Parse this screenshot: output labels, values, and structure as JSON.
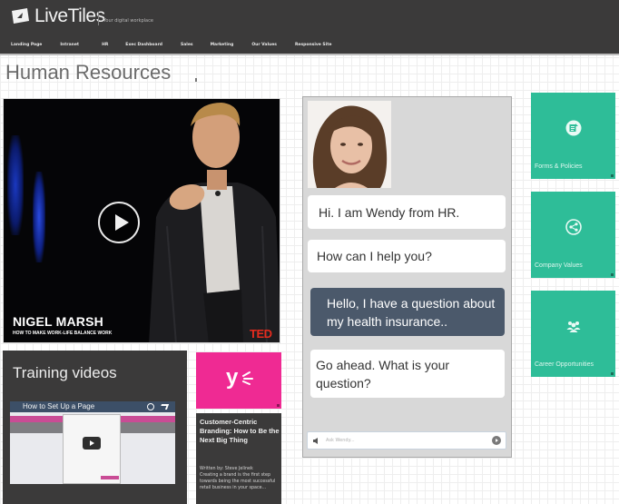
{
  "header": {
    "brand": "LiveTiles",
    "tagline": "Your digital workplace",
    "nav": [
      "Landing Page",
      "Intranet",
      "HR",
      "Exec Dashboard",
      "Sales",
      "Marketing",
      "Our Values",
      "Responsive Site"
    ]
  },
  "page": {
    "title": "Human Resources"
  },
  "video": {
    "speaker_name": "NIGEL MARSH",
    "talk_title": "HOW TO MAKE WORK-LIFE BALANCE WORK",
    "brand_mark": "TED",
    "play_icon": "play-icon"
  },
  "chat": {
    "agent_name": "Wendy",
    "messages": [
      {
        "from": "bot",
        "text": "Hi. I am Wendy from HR."
      },
      {
        "from": "bot",
        "text": "How can I help you?"
      },
      {
        "from": "user",
        "text": "Hello, I have a question about my health insurance.."
      },
      {
        "from": "bot",
        "text": "Go ahead. What is your question?"
      }
    ],
    "input_placeholder": "Ask Wendy...",
    "input_value": ""
  },
  "tiles": {
    "forms": {
      "label": "Forms & Policies",
      "icon": "forms-icon"
    },
    "values": {
      "label": "Company Values",
      "icon": "share-icon"
    },
    "career": {
      "label": "Career Opportunities",
      "icon": "people-icon"
    }
  },
  "training": {
    "title": "Training videos",
    "thumb_title": "How to Set Up a Page"
  },
  "yammer": {
    "logo_text": "y"
  },
  "article": {
    "title": "Customer-Centric Branding: How to Be the Next Big Thing",
    "author": "Written by: Steve Jelinek",
    "excerpt": "Creating a brand is the first step towards being the most successful retail business in your space..."
  },
  "colors": {
    "topbar": "#3b3a3a",
    "tile_green": "#2ebd98",
    "yammer_pink": "#ef2a93",
    "user_bubble": "#4b596b",
    "ted_red": "#e62b1e"
  }
}
